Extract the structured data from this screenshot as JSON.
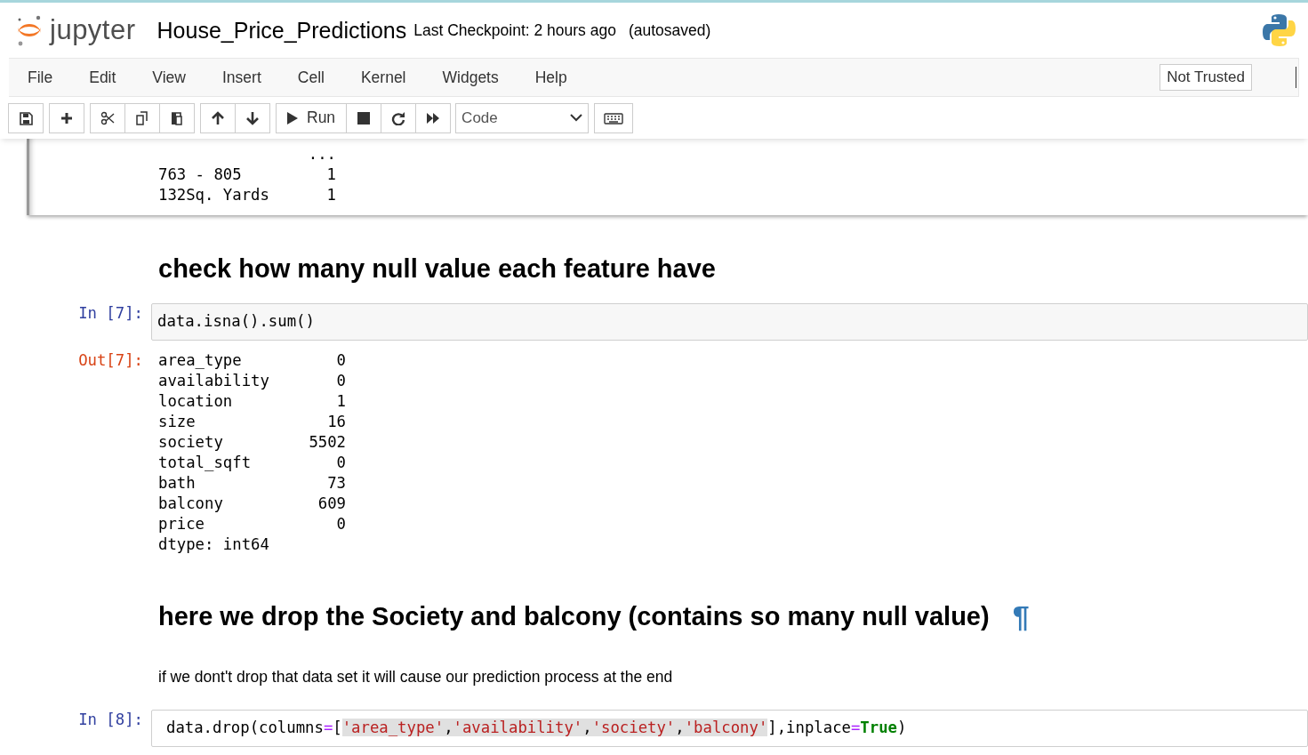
{
  "header": {
    "logo_text": "jupyter",
    "notebook_title": "House_Price_Predictions",
    "checkpoint": "Last Checkpoint: 2 hours ago",
    "autosave": "(autosaved)"
  },
  "menu": {
    "items": [
      "File",
      "Edit",
      "View",
      "Insert",
      "Cell",
      "Kernel",
      "Widgets",
      "Help"
    ],
    "trust": "Not Trusted"
  },
  "toolbar": {
    "run_label": "Run",
    "cell_type": "Code"
  },
  "cells": [
    {
      "kind": "output-tail",
      "rows": [
        {
          "label": "",
          "value": "..."
        },
        {
          "label": "763 - 805",
          "value": "1"
        },
        {
          "label": "132Sq. Yards",
          "value": "1"
        }
      ]
    },
    {
      "kind": "heading",
      "text": "check how many null value each feature have"
    },
    {
      "kind": "code",
      "prompt": "In [7]:",
      "tokens": [
        {
          "kind": "name",
          "text": "data.isna().sum()",
          "selected": false
        }
      ],
      "output": {
        "prompt": "Out[7]:",
        "rows": [
          {
            "label": "area_type",
            "value": "0"
          },
          {
            "label": "availability",
            "value": "0"
          },
          {
            "label": "location",
            "value": "1"
          },
          {
            "label": "size",
            "value": "16"
          },
          {
            "label": "society",
            "value": "5502"
          },
          {
            "label": "total_sqft",
            "value": "0"
          },
          {
            "label": "bath",
            "value": "73"
          },
          {
            "label": "balcony",
            "value": "609"
          },
          {
            "label": "price",
            "value": "0"
          }
        ],
        "footer": "dtype: int64"
      }
    },
    {
      "kind": "heading",
      "text": "here we drop the Society and balcony (contains so many null value)",
      "anchor": "¶"
    },
    {
      "kind": "text",
      "text": "if we dont't drop that data set it will cause our prediction process at the end"
    },
    {
      "kind": "code",
      "prompt": "In [8]:",
      "tokens": [
        {
          "kind": "name",
          "text": "data.drop(columns",
          "selected": false
        },
        {
          "kind": "operator",
          "text": "=",
          "selected": false
        },
        {
          "kind": "name",
          "text": "[",
          "selected": false
        },
        {
          "kind": "string",
          "text": "'area_type'",
          "selected": true
        },
        {
          "kind": "name",
          "text": ",",
          "selected": true
        },
        {
          "kind": "string",
          "text": "'availability'",
          "selected": true
        },
        {
          "kind": "name",
          "text": ",",
          "selected": true
        },
        {
          "kind": "string",
          "text": "'society'",
          "selected": true
        },
        {
          "kind": "name",
          "text": ",",
          "selected": true
        },
        {
          "kind": "string",
          "text": "'balcony'",
          "selected": true
        },
        {
          "kind": "name",
          "text": "],inplace",
          "selected": false
        },
        {
          "kind": "operator",
          "text": "=",
          "selected": false
        },
        {
          "kind": "keyword",
          "text": "True",
          "selected": false
        },
        {
          "kind": "name",
          "text": ")",
          "selected": false
        }
      ]
    }
  ]
}
